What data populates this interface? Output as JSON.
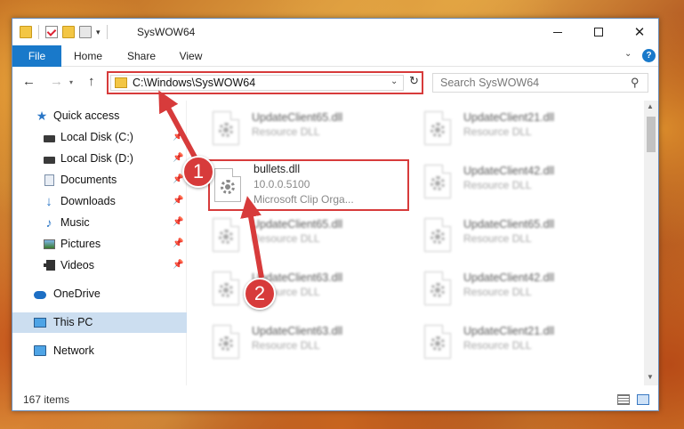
{
  "window": {
    "title": "SysWOW64",
    "min_icon": "minimize-icon",
    "max_icon": "maximize-icon",
    "close_label": "✕"
  },
  "ribbon": {
    "tabs": [
      "File",
      "Home",
      "Share",
      "View"
    ],
    "help_label": "?"
  },
  "navigation": {
    "address": "C:\\Windows\\SysWOW64",
    "search_placeholder": "Search SysWOW64"
  },
  "sidebar": {
    "items": [
      {
        "label": "Quick access",
        "icon": "star-icon"
      },
      {
        "label": "Local Disk (C:)",
        "icon": "drive-icon",
        "pinned": true
      },
      {
        "label": "Local Disk (D:)",
        "icon": "drive-icon",
        "pinned": true
      },
      {
        "label": "Documents",
        "icon": "documents-icon",
        "pinned": true
      },
      {
        "label": "Downloads",
        "icon": "download-icon",
        "pinned": true
      },
      {
        "label": "Music",
        "icon": "music-icon",
        "pinned": true
      },
      {
        "label": "Pictures",
        "icon": "pictures-icon",
        "pinned": true
      },
      {
        "label": "Videos",
        "icon": "videos-icon",
        "pinned": true
      },
      {
        "label": "OneDrive",
        "icon": "cloud-icon"
      },
      {
        "label": "This PC",
        "icon": "computer-icon",
        "selected": true
      },
      {
        "label": "Network",
        "icon": "network-icon"
      }
    ]
  },
  "files": [
    {
      "name": "UpdateClient65.dll",
      "type": "Resource DLL"
    },
    {
      "name": "UpdateClient21.dll",
      "type": "Resource DLL"
    },
    {
      "name": "bullets.dll",
      "version": "10.0.0.5100",
      "description": "Microsoft Clip Orga...",
      "highlighted": true
    },
    {
      "name": "UpdateClient42.dll",
      "type": "Resource DLL"
    },
    {
      "name": "UpdateClient65.dll",
      "type": "Resource DLL"
    },
    {
      "name": "UpdateClient65.dll",
      "type": "Resource DLL"
    },
    {
      "name": "UpdateClient63.dll",
      "type": "Resource DLL"
    },
    {
      "name": "UpdateClient42.dll",
      "type": "Resource DLL"
    },
    {
      "name": "UpdateClient63.dll",
      "type": "Resource DLL"
    },
    {
      "name": "UpdateClient21.dll",
      "type": "Resource DLL"
    }
  ],
  "status": {
    "item_count": "167 items"
  },
  "annotations": {
    "step1": "1",
    "step2": "2",
    "accent_color": "#d73b3b"
  }
}
